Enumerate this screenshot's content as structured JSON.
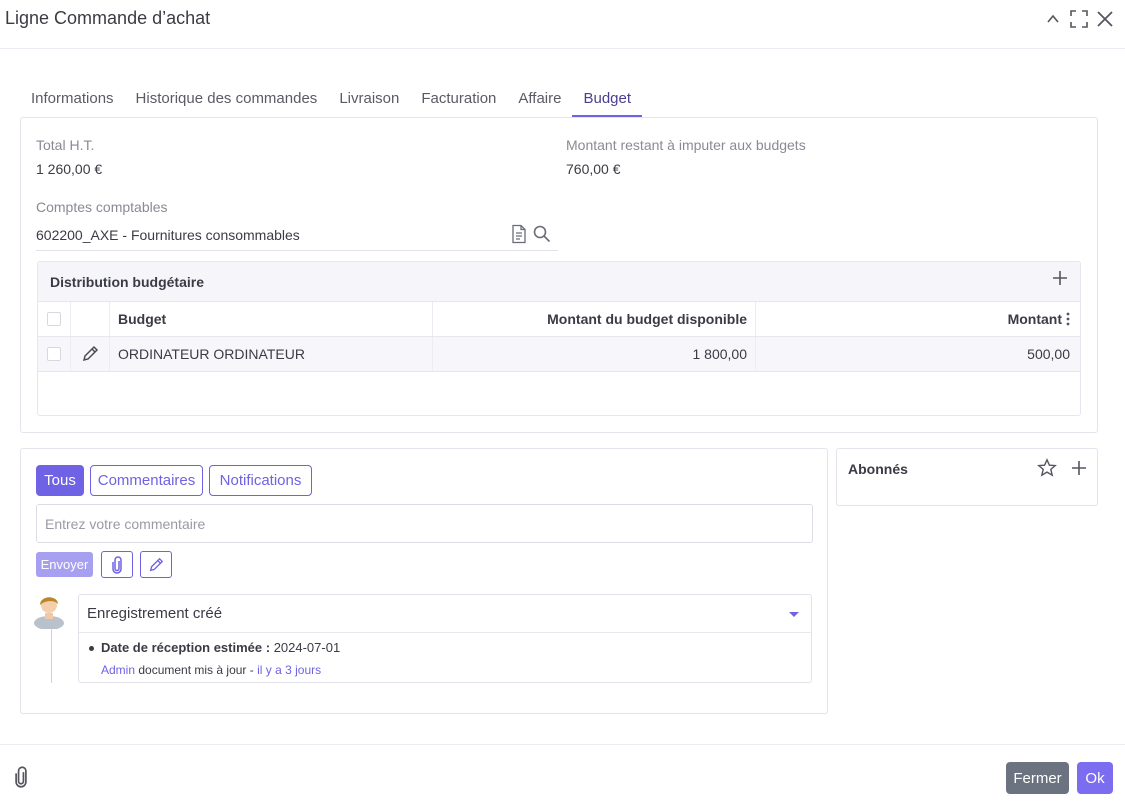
{
  "dialog": {
    "title": "Ligne Commande d’achat"
  },
  "tabs": [
    {
      "label": "Informations"
    },
    {
      "label": "Historique des commandes"
    },
    {
      "label": "Livraison"
    },
    {
      "label": "Facturation"
    },
    {
      "label": "Affaire"
    },
    {
      "label": "Budget",
      "active": true
    }
  ],
  "budget": {
    "total_ht_label": "Total H.T.",
    "total_ht_value": "1 260,00 €",
    "remaining_label": "Montant restant à imputer aux budgets",
    "remaining_value": "760,00 €",
    "accounts_label": "Comptes comptables",
    "accounts_value": "602200_AXE - Fournitures consommables"
  },
  "distribution": {
    "title": "Distribution budgétaire",
    "columns": [
      "Budget",
      "Montant du budget disponible",
      "Montant"
    ],
    "rows": [
      {
        "budget": "ORDINATEUR ORDINATEUR",
        "available": "1 800,00",
        "amount": "500,00"
      }
    ]
  },
  "comments": {
    "filters": [
      "Tous",
      "Commentaires",
      "Notifications"
    ],
    "placeholder": "Entrez votre commentaire",
    "send_label": "Envoyer",
    "activity": {
      "title": "Enregistrement créé",
      "field_label": "Date de réception estimée :",
      "field_value": "2024-07-01",
      "author": "Admin",
      "action": "document mis à jour -",
      "time": "il y a 3 jours"
    }
  },
  "followers": {
    "title": "Abonnés"
  },
  "footer": {
    "close_label": "Fermer",
    "ok_label": "Ok"
  },
  "colors": {
    "accent": "#6f62e4",
    "close_button": "#6b7280"
  }
}
